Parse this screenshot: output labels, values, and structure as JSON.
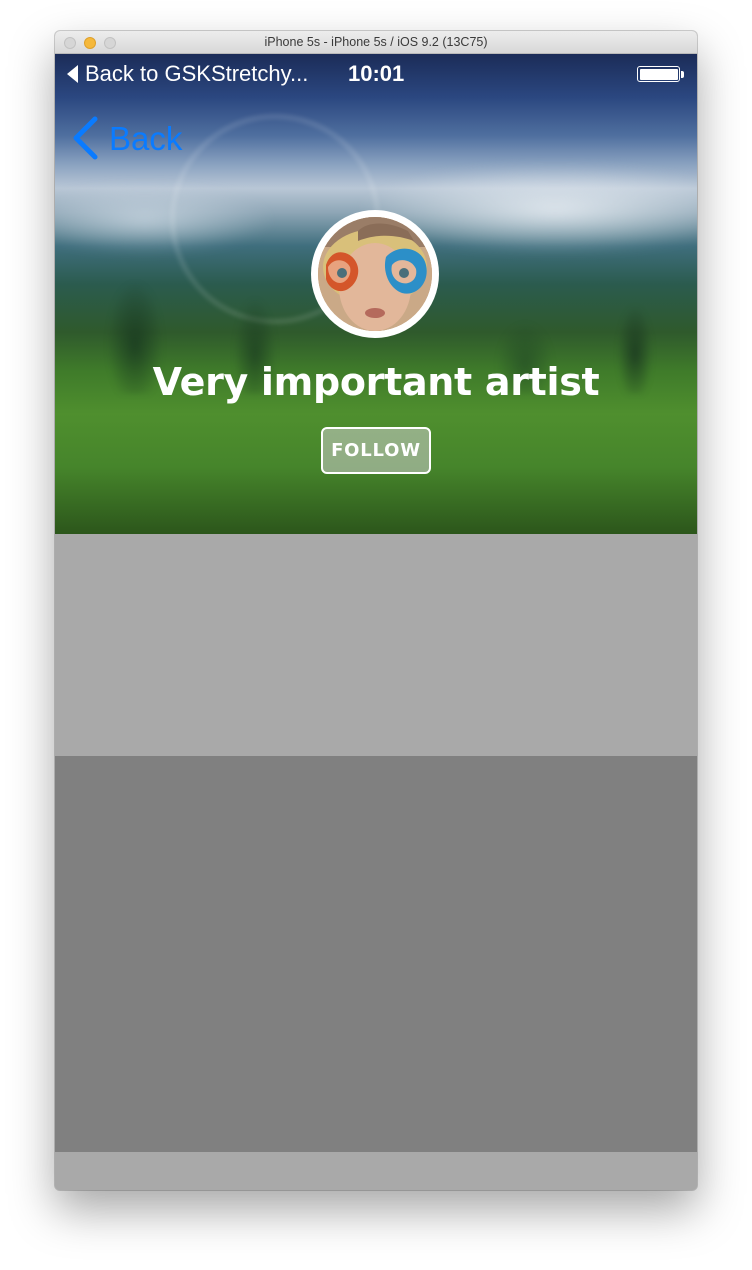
{
  "window": {
    "title": "iPhone 5s - iPhone 5s / iOS 9.2 (13C75)"
  },
  "statusbar": {
    "back_to_app": "Back to GSKStretchy...",
    "time": "10:01",
    "battery_level": 1.0
  },
  "nav": {
    "back_label": "Back",
    "back_color": "#0a7bff"
  },
  "header": {
    "artist_name": "Very important artist",
    "follow_label": "FOLLOW"
  },
  "icons": {
    "status_back": "triangle-left-icon",
    "nav_back": "chevron-left-icon",
    "battery": "battery-icon"
  },
  "colors": {
    "content_light": "#a9a9a9",
    "content_dark": "#808080"
  }
}
